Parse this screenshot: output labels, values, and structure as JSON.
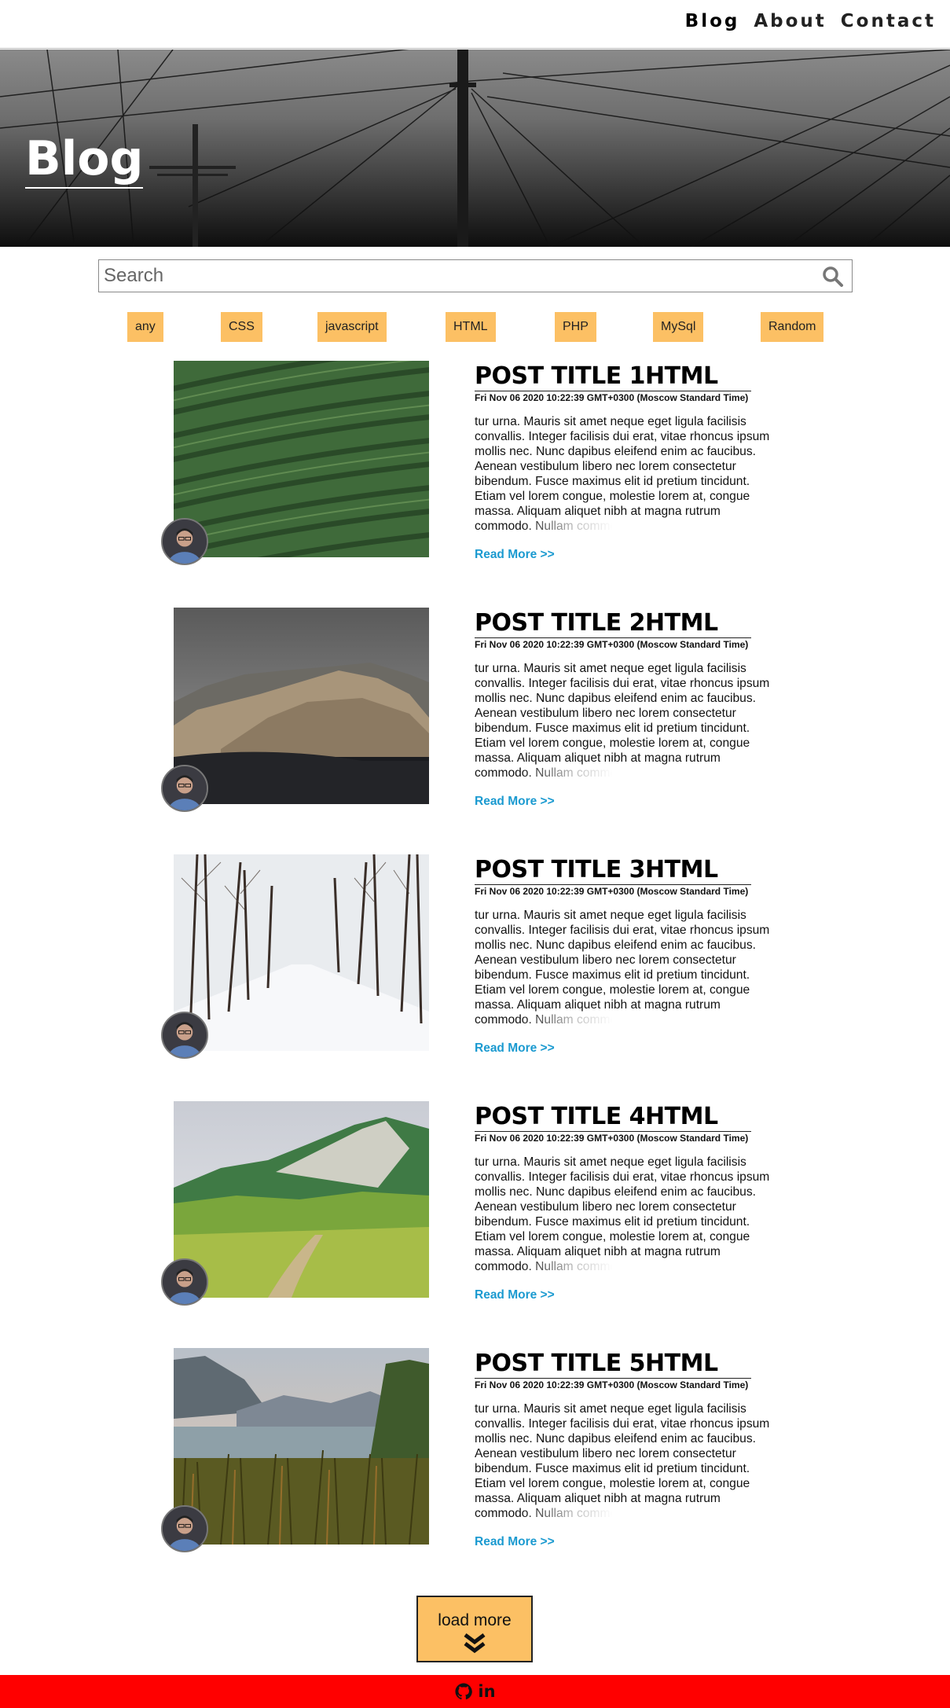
{
  "nav": {
    "links": [
      "Blog",
      "About",
      "Contact"
    ]
  },
  "hero": {
    "title": "Blog"
  },
  "search": {
    "placeholder": "Search",
    "icon": "search-icon"
  },
  "tags": [
    "any",
    "CSS",
    "javascript",
    "HTML",
    "PHP",
    "MySql",
    "Random"
  ],
  "posts": [
    {
      "title": "POST TITLE 1HTML",
      "date": "Fri Nov 06 2020 10:22:39 GMT+0300 (Moscow Standard Time)",
      "excerpt": "tur urna. Mauris sit amet neque eget ligula facilisis convallis. Integer facilisis dui erat, vitae rhoncus ipsum mollis nec. Nunc dapibus eleifend enim ac faucibus. Aenean vestibulum libero nec lorem consectetur bibendum. Fusce maximus elit id pretium tincidunt. Etiam vel lorem congue, molestie lorem at, congue massa. Aliquam aliquet nibh at magna rutrum commodo. Nullam commodo",
      "read_more": "Read More >>",
      "image": "tea-plantation-rows"
    },
    {
      "title": "POST TITLE 2HTML",
      "date": "Fri Nov 06 2020 10:22:39 GMT+0300 (Moscow Standard Time)",
      "excerpt": "tur urna. Mauris sit amet neque eget ligula facilisis convallis. Integer facilisis dui erat, vitae rhoncus ipsum mollis nec. Nunc dapibus eleifend enim ac faucibus. Aenean vestibulum libero nec lorem consectetur bibendum. Fusce maximus elit id pretium tincidunt. Etiam vel lorem congue, molestie lorem at, congue massa. Aliquam aliquet nibh at magna rutrum commodo. Nullam commodo",
      "read_more": "Read More >>",
      "image": "rocky-cliffs-over-sea"
    },
    {
      "title": "POST TITLE 3HTML",
      "date": "Fri Nov 06 2020 10:22:39 GMT+0300 (Moscow Standard Time)",
      "excerpt": "tur urna. Mauris sit amet neque eget ligula facilisis convallis. Integer facilisis dui erat, vitae rhoncus ipsum mollis nec. Nunc dapibus eleifend enim ac faucibus. Aenean vestibulum libero nec lorem consectetur bibendum. Fusce maximus elit id pretium tincidunt. Etiam vel lorem congue, molestie lorem at, congue massa. Aliquam aliquet nibh at magna rutrum commodo. Nullam commodo",
      "read_more": "Read More >>",
      "image": "snowy-tree-lined-road"
    },
    {
      "title": "POST TITLE 4HTML",
      "date": "Fri Nov 06 2020 10:22:39 GMT+0300 (Moscow Standard Time)",
      "excerpt": "tur urna. Mauris sit amet neque eget ligula facilisis convallis. Integer facilisis dui erat, vitae rhoncus ipsum mollis nec. Nunc dapibus eleifend enim ac faucibus. Aenean vestibulum libero nec lorem consectetur bibendum. Fusce maximus elit id pretium tincidunt. Etiam vel lorem congue, molestie lorem at, congue massa. Aliquam aliquet nibh at magna rutrum commodo. Nullam commodo",
      "read_more": "Read More >>",
      "image": "green-mountain-meadow"
    },
    {
      "title": "POST TITLE 5HTML",
      "date": "Fri Nov 06 2020 10:22:39 GMT+0300 (Moscow Standard Time)",
      "excerpt": "tur urna. Mauris sit amet neque eget ligula facilisis convallis. Integer facilisis dui erat, vitae rhoncus ipsum mollis nec. Nunc dapibus eleifend enim ac faucibus. Aenean vestibulum libero nec lorem consectetur bibendum. Fusce maximus elit id pretium tincidunt. Etiam vel lorem congue, molestie lorem at, congue massa. Aliquam aliquet nibh at magna rutrum commodo. Nullam commodo",
      "read_more": "Read More >>",
      "image": "lake-with-reeds-and-mountains"
    }
  ],
  "load_more": {
    "label": "load more",
    "icon": "double-chevron-down-icon"
  },
  "footer": {
    "icons": [
      "github-icon",
      "linkedin-icon"
    ],
    "linkedin_text": "in"
  },
  "colors": {
    "tag_bg": "#fcc064",
    "read_more": "#1b9ad0",
    "footer_bg": "#ff0000"
  }
}
